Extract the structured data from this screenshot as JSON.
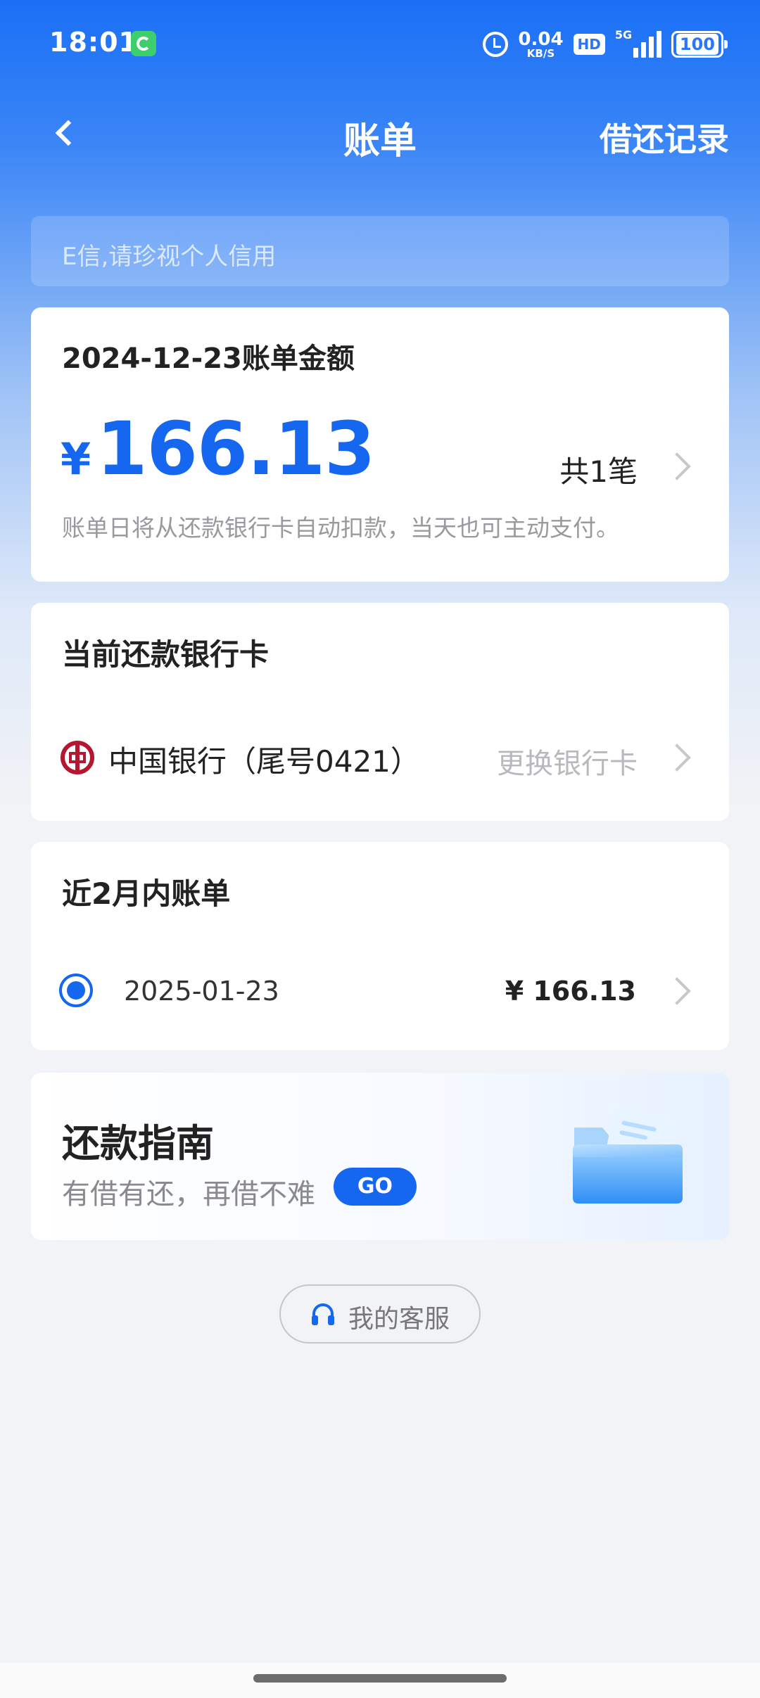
{
  "status_bar": {
    "time": "18:01",
    "net_speed_value": "0.04",
    "net_speed_unit": "KB/S",
    "hd_label": "HD",
    "network_label": "5G",
    "battery": "100"
  },
  "header": {
    "title": "账单",
    "records_link": "借还记录"
  },
  "notice": {
    "text": "E信,请珍视个人信用"
  },
  "bill": {
    "title": "2024-12-23账单金额",
    "currency": "¥",
    "amount": "166.13",
    "count": "共1笔",
    "note": "账单日将从还款银行卡自动扣款，当天也可主动支付。"
  },
  "bank_card": {
    "title": "当前还款银行卡",
    "bank": "中国银行（尾号0421）",
    "change_label": "更换银行卡"
  },
  "recent_bills": {
    "title": "近2月内账单",
    "items": [
      {
        "date": "2025-01-23",
        "amount": "¥ 166.13",
        "selected": true
      }
    ]
  },
  "guide": {
    "title": "还款指南",
    "subtitle": "有借有还，再借不难",
    "button": "GO"
  },
  "service": {
    "label": "我的客服"
  },
  "colors": {
    "primary": "#1567f0",
    "bank_red": "#b4172f",
    "background": "#f2f3f6"
  }
}
